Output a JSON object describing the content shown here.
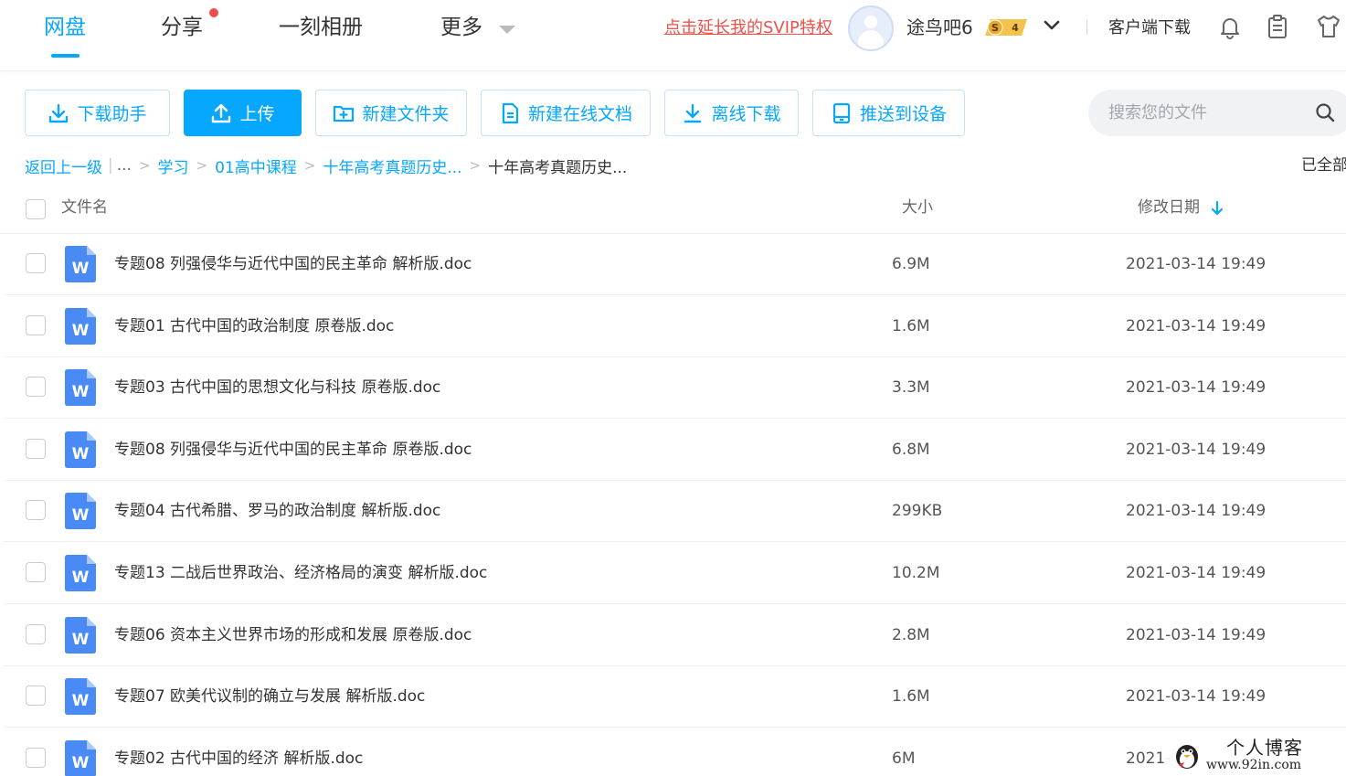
{
  "nav": {
    "tabs": [
      {
        "label": "网盘",
        "active": true
      },
      {
        "label": "分享",
        "has_dot": true
      },
      {
        "label": "一刻相册"
      },
      {
        "label": "更多"
      }
    ],
    "svip_link": "点击延长我的SVIP特权",
    "username": "途鸟吧6",
    "vip_badge": {
      "symbol": "S",
      "level": "4"
    },
    "client_download": "客户端下载",
    "icons": [
      "bell-icon",
      "clipboard-icon",
      "shirt-icon"
    ]
  },
  "toolbar": {
    "download_helper": "下载助手",
    "upload": "上传",
    "new_folder": "新建文件夹",
    "new_online_doc": "新建在线文档",
    "offline_download": "离线下载",
    "push_to_device": "推送到设备",
    "search_placeholder": "搜索您的文件"
  },
  "breadcrumb": {
    "back": "返回上一级",
    "dots": "...",
    "items": [
      "学习",
      "01高中课程",
      "十年高考真题历史..."
    ],
    "current": "十年高考真题历史...",
    "loaded_status": "已全部"
  },
  "table": {
    "headers": {
      "name": "文件名",
      "size": "大小",
      "date": "修改日期"
    },
    "rows": [
      {
        "name": "专题08 列强侵华与近代中国的民主革命 解析版.doc",
        "size": "6.9M",
        "date": "2021-03-14 19:49"
      },
      {
        "name": "专题01 古代中国的政治制度 原卷版.doc",
        "size": "1.6M",
        "date": "2021-03-14 19:49"
      },
      {
        "name": "专题03 古代中国的思想文化与科技 原卷版.doc",
        "size": "3.3M",
        "date": "2021-03-14 19:49"
      },
      {
        "name": "专题08 列强侵华与近代中国的民主革命 原卷版.doc",
        "size": "6.8M",
        "date": "2021-03-14 19:49"
      },
      {
        "name": "专题04 古代希腊、罗马的政治制度 解析版.doc",
        "size": "299KB",
        "date": "2021-03-14 19:49"
      },
      {
        "name": "专题13 二战后世界政治、经济格局的演变 解析版.doc",
        "size": "10.2M",
        "date": "2021-03-14 19:49"
      },
      {
        "name": "专题06 资本主义世界市场的形成和发展 原卷版.doc",
        "size": "2.8M",
        "date": "2021-03-14 19:49"
      },
      {
        "name": "专题07 欧美代议制的确立与发展 解析版.doc",
        "size": "1.6M",
        "date": "2021-03-14 19:49"
      },
      {
        "name": "专题02 古代中国的经济 解析版.doc",
        "size": "6M",
        "date": "2021-"
      }
    ],
    "file_icon_letter": "W"
  },
  "watermark": {
    "line1": "个人博客",
    "line2": "www.92in.com"
  },
  "colors": {
    "accent": "#06a7ff",
    "svip_red": "#f0504a",
    "word_blue": "#4a8af4"
  }
}
